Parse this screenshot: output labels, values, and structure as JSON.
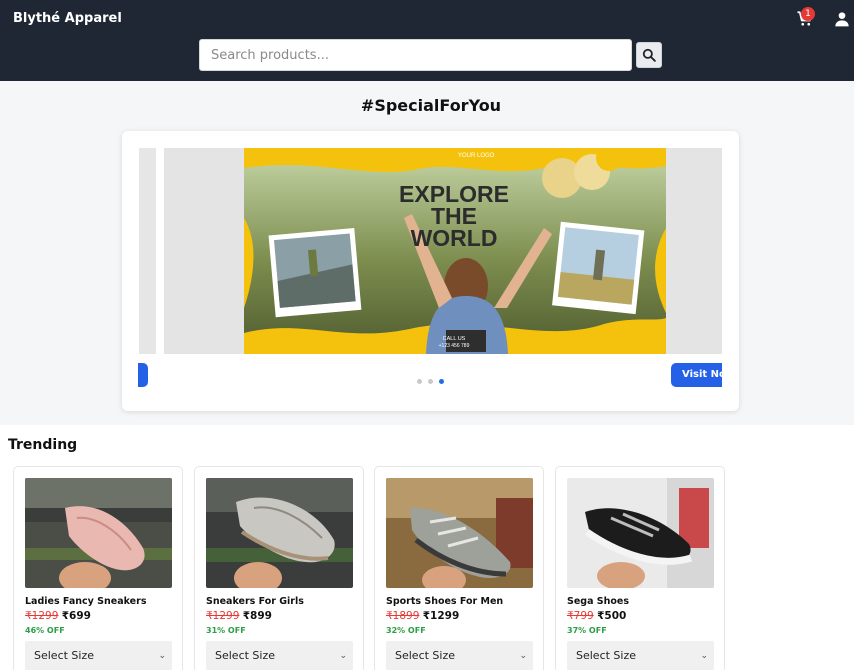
{
  "header": {
    "brand": "Blythé Apparel",
    "cart_count": "1",
    "search_placeholder": "Search products..."
  },
  "hero": {
    "title": "#SpecialForYou",
    "slide_text_1": "EXPLORE",
    "slide_text_2": "THE",
    "slide_text_3": "WORLD",
    "slide_logo": "YOUR LOGO",
    "slide_call": "CALL US",
    "slide_phone": "+123 456 789",
    "visit_label": "Visit Now",
    "active_dot": 3
  },
  "trending": {
    "title": "Trending",
    "products": [
      {
        "name": "Ladies Fancy Sneakers",
        "old_price": "₹1299",
        "price": "₹699",
        "discount": "46% OFF",
        "size_label": "Select Size"
      },
      {
        "name": "Sneakers For Girls",
        "old_price": "₹1299",
        "price": "₹899",
        "discount": "31% OFF",
        "size_label": "Select Size"
      },
      {
        "name": "Sports Shoes For Men",
        "old_price": "₹1899",
        "price": "₹1299",
        "discount": "32% OFF",
        "size_label": "Select Size"
      },
      {
        "name": "Sega Shoes",
        "old_price": "₹799",
        "price": "₹500",
        "discount": "37% OFF",
        "size_label": "Select Size"
      }
    ]
  },
  "colors": {
    "header_bg": "#1f2735",
    "accent_blue": "#2561e6",
    "price_old": "#e53935",
    "discount_green": "#2e9d45",
    "badge_red": "#e53935"
  },
  "icons": [
    "cart-icon",
    "user-icon",
    "search-icon",
    "chevron-down-icon"
  ]
}
